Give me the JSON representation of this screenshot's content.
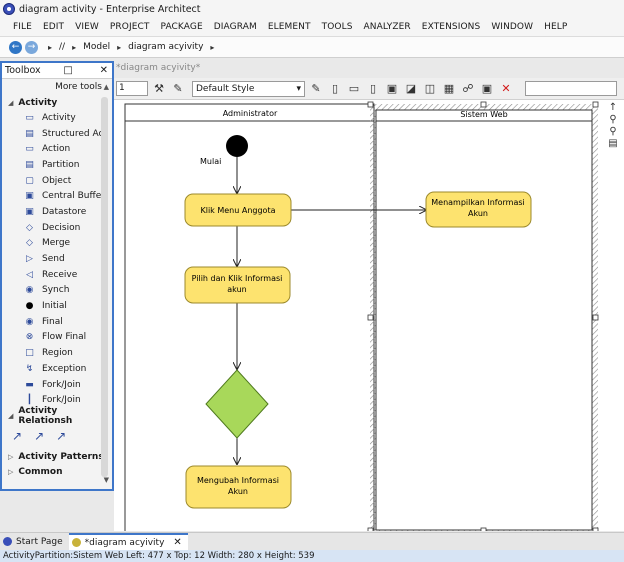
{
  "window": {
    "title": "diagram activity - Enterprise Architect"
  },
  "menu": [
    "FILE",
    "EDIT",
    "VIEW",
    "PROJECT",
    "PACKAGE",
    "DIAGRAM",
    "ELEMENT",
    "TOOLS",
    "ANALYZER",
    "EXTENSIONS",
    "WINDOW",
    "HELP"
  ],
  "breadcrumb": [
    "//",
    "Model",
    "diagram acyivity"
  ],
  "toolbar": {
    "zoom_value": "1",
    "style_value": "Default Style"
  },
  "top_tab_label": "*diagram acyivity*",
  "toolbox": {
    "title": "Toolbox",
    "more_tools": "More tools",
    "sections": {
      "activity": "Activity",
      "relationships": "Activity Relationsh",
      "patterns": "Activity Patterns",
      "common": "Common"
    },
    "items": [
      {
        "label": "Activity",
        "icon": "activity-icon"
      },
      {
        "label": "Structured Ac",
        "icon": "structured-activity-icon"
      },
      {
        "label": "Action",
        "icon": "action-icon"
      },
      {
        "label": "Partition",
        "icon": "partition-icon"
      },
      {
        "label": "Object",
        "icon": "object-icon"
      },
      {
        "label": "Central Buffe",
        "icon": "central-buffer-icon"
      },
      {
        "label": "Datastore",
        "icon": "datastore-icon"
      },
      {
        "label": "Decision",
        "icon": "decision-icon"
      },
      {
        "label": "Merge",
        "icon": "merge-icon"
      },
      {
        "label": "Send",
        "icon": "send-icon"
      },
      {
        "label": "Receive",
        "icon": "receive-icon"
      },
      {
        "label": "Synch",
        "icon": "synch-icon"
      },
      {
        "label": "Initial",
        "icon": "initial-icon"
      },
      {
        "label": "Final",
        "icon": "final-icon"
      },
      {
        "label": "Flow Final",
        "icon": "flow-final-icon"
      },
      {
        "label": "Region",
        "icon": "region-icon"
      },
      {
        "label": "Exception",
        "icon": "exception-icon"
      },
      {
        "label": "Fork/Join",
        "icon": "fork-join-icon"
      },
      {
        "label": "Fork/Join",
        "icon": "fork-join-vertical-icon"
      }
    ]
  },
  "diagram": {
    "lanes": [
      "Administrator",
      "Sistem Web"
    ],
    "initial_label": "Mulai",
    "actions": {
      "klik_menu": "Klik Menu Anggota",
      "pilih_klik": [
        "Pilih dan Klik Informasi",
        "akun"
      ],
      "menampilkan": [
        "Menampilkan Informasi",
        "Akun"
      ],
      "mengubah": [
        "Mengubah Informasi",
        "Akun"
      ]
    },
    "colors": {
      "action_fill": "#fde36f",
      "action_border": "#9c8a2c",
      "decision_fill": "#a8d85a"
    }
  },
  "tabs": [
    {
      "label": "Start Page",
      "active": false
    },
    {
      "label": "*diagram acyivity",
      "active": true
    }
  ],
  "status": {
    "text": "ActivityPartition:Sistem Web   Left:  477 x Top:  12   Width:  280 x Height:  539"
  }
}
